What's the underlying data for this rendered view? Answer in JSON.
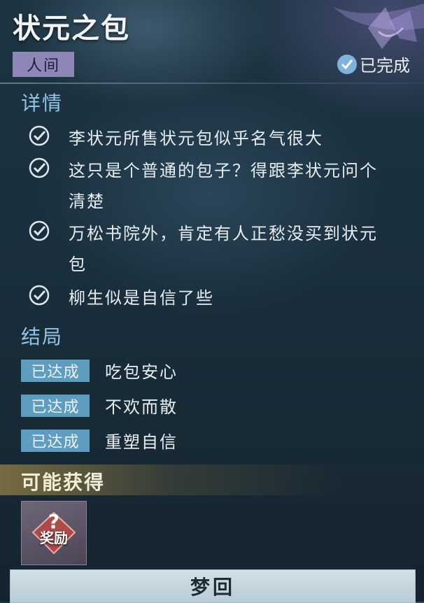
{
  "quest": {
    "title": "状元之包",
    "realm": "人间",
    "status": "已完成"
  },
  "details": {
    "heading": "详情",
    "items": [
      {
        "line1": "李状元所售状元包似乎名气很大",
        "line2": ""
      },
      {
        "line1": "这只是个普通的包子？得跟李状元问个",
        "line2": "清楚"
      },
      {
        "line1": "万松书院外，肯定有人正愁没买到状元",
        "line2": "包"
      },
      {
        "line1": "柳生似是自信了些",
        "line2": ""
      }
    ]
  },
  "endings": {
    "heading": "结局",
    "items": [
      {
        "badge": "已达成",
        "text": "吃包安心"
      },
      {
        "badge": "已达成",
        "text": "不欢而散"
      },
      {
        "badge": "已达成",
        "text": "重塑自信"
      }
    ]
  },
  "rewards": {
    "heading": "可能获得",
    "item_label": "奖励",
    "item_icon": "question-mark-icon"
  },
  "action": {
    "label": "梦回"
  },
  "colors": {
    "accent_blue": "#8fc5e8",
    "badge": "#5f9dc0",
    "realm_tag": "#8f86b8"
  }
}
